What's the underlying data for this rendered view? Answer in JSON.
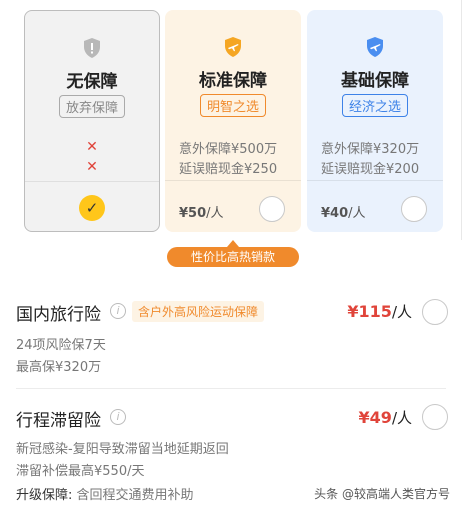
{
  "colors": {
    "accent_orange": "#f08a2c",
    "price_red": "#e0443a",
    "check_yellow": "#ffc61a",
    "basic_blue": "#3d82e8"
  },
  "plans": [
    {
      "icon": "shield-gray-icon",
      "title": "无保障",
      "tag": "放弃保障",
      "selected": true
    },
    {
      "icon": "shield-plane-orange-icon",
      "title": "标准保障",
      "tag": "明智之选",
      "features": [
        "意外保障¥500万",
        "延误赔现金¥250"
      ],
      "price": "¥50",
      "unit": "/人"
    },
    {
      "icon": "shield-plane-blue-icon",
      "title": "基础保障",
      "tag": "经济之选",
      "features": [
        "意外保障¥320万",
        "延误赔现金¥200"
      ],
      "price": "¥40",
      "unit": "/人"
    }
  ],
  "none_marks": [
    "✕",
    "✕"
  ],
  "check_glyph": "✓",
  "promo": "性价比高热销款",
  "domestic": {
    "title": "国内旅行险",
    "info": "i",
    "badge": "含户外高风险运动保障",
    "price": "¥115",
    "unit": "/人",
    "lines": [
      "24项风险保7天",
      "最高保¥320万"
    ]
  },
  "delay": {
    "title": "行程滞留险",
    "info": "i",
    "price": "¥49",
    "unit": "/人",
    "lines": [
      "新冠感染-复阳导致滞留当地延期返回",
      "滞留补偿最高¥550/天"
    ],
    "upgrade_label": "升级保障:",
    "upgrade_text": "含回程交通费用补助"
  },
  "watermark": "头条 @较高端人类官方号"
}
